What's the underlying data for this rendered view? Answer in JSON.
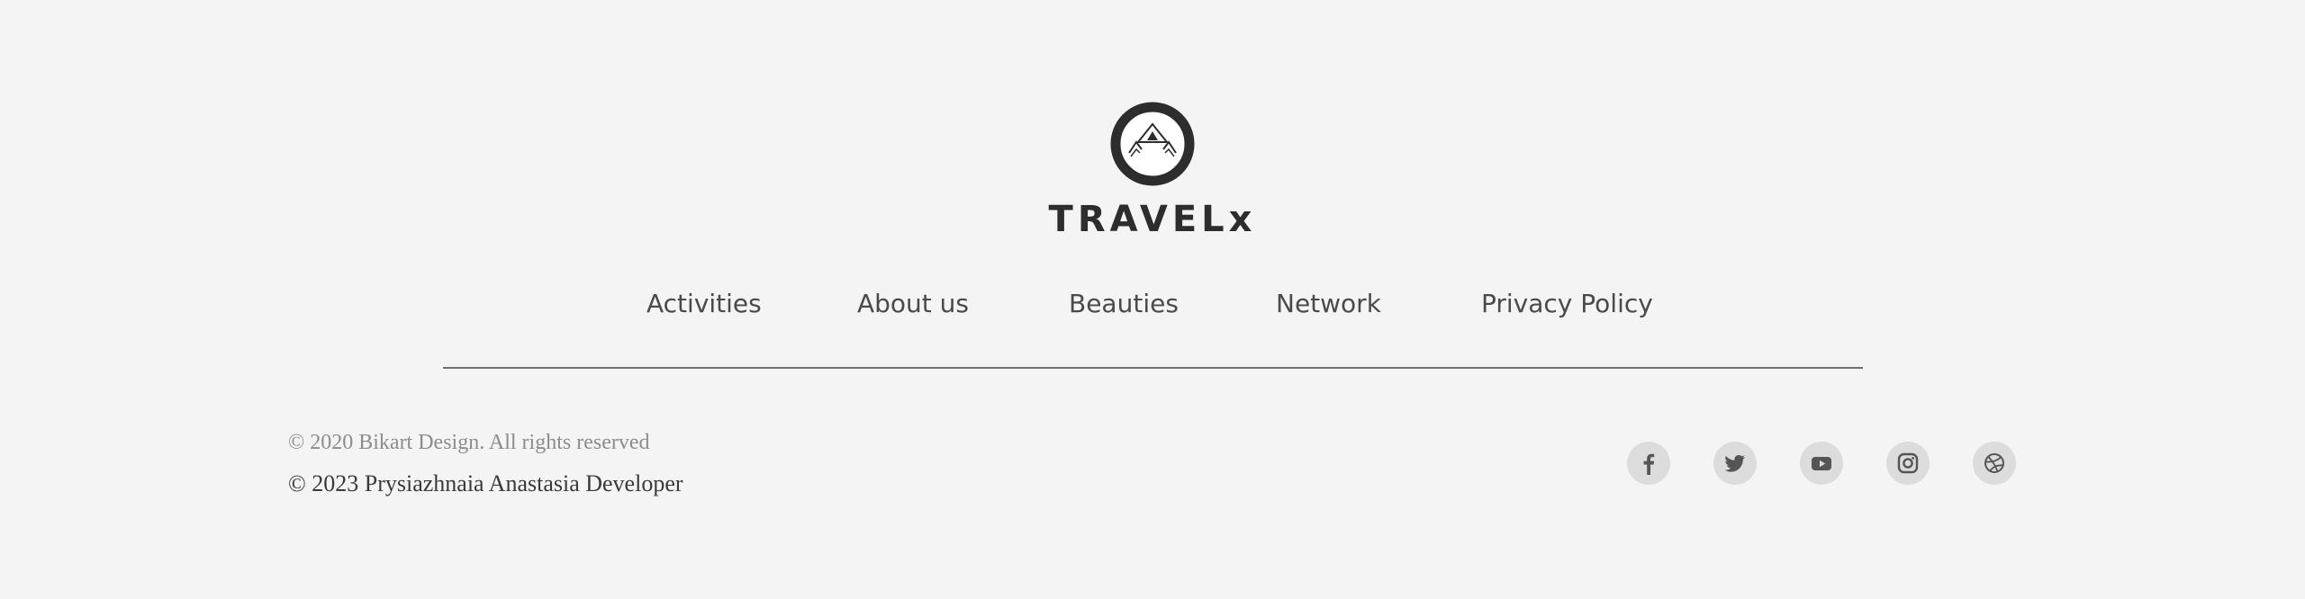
{
  "brand": {
    "name": "TRAVELx",
    "logo_icon": "mountain-logo-icon",
    "color": "#2d2d2d"
  },
  "nav": {
    "items": [
      {
        "label": "Activities"
      },
      {
        "label": "About us"
      },
      {
        "label": "Beauties"
      },
      {
        "label": "Network"
      },
      {
        "label": "Privacy Policy"
      }
    ]
  },
  "footer": {
    "copyright_primary": "© 2020 Bikart Design. All rights reserved",
    "copyright_secondary": "© 2023 Prysiazhnaia Anastasia Developer",
    "social": [
      {
        "icon": "facebook-icon"
      },
      {
        "icon": "twitter-icon"
      },
      {
        "icon": "youtube-icon"
      },
      {
        "icon": "instagram-icon"
      },
      {
        "icon": "dribbble-icon"
      }
    ]
  },
  "colors": {
    "background": "#f4f4f4",
    "text": "#4a4a4a",
    "muted": "#8c8c8c",
    "social_bg": "#dcdcdc",
    "social_icon": "#555555"
  }
}
